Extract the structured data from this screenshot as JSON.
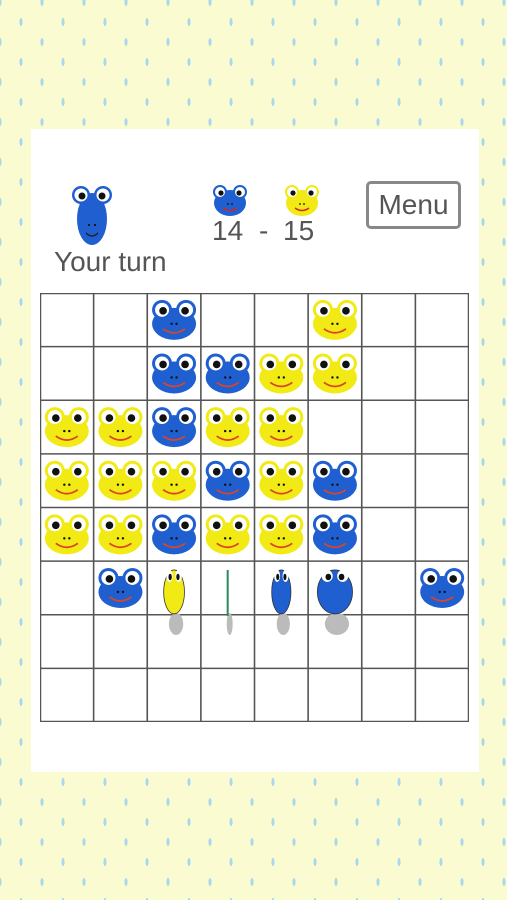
{
  "status": {
    "turn_label": "Your turn"
  },
  "score": {
    "blue": "14",
    "separator": "-",
    "yellow": "15"
  },
  "menu": {
    "label": "Menu"
  },
  "board": {
    "size": 8,
    "rows": [
      "..B..Y..",
      "..BBYY..",
      "YYBYY...",
      "YYYBYB..",
      "YYBYYB..",
      ".B...B B",
      "........",
      "........"
    ],
    "flipping": [
      {
        "row": 5,
        "col": 2,
        "from": "Y",
        "to": "B"
      },
      {
        "row": 5,
        "col": 3,
        "from": "Y",
        "to": "B"
      },
      {
        "row": 5,
        "col": 4,
        "from": "Y",
        "to": "B"
      },
      {
        "row": 5,
        "col": 5,
        "from": "Y",
        "to": "B"
      }
    ]
  },
  "colors": {
    "blue_frog": "#1f5fd0",
    "yellow_frog": "#f2ea14",
    "grid_line": "#555555",
    "text": "#555555",
    "background": "#fbfbd2",
    "raindrop": "#a9d8ea"
  }
}
